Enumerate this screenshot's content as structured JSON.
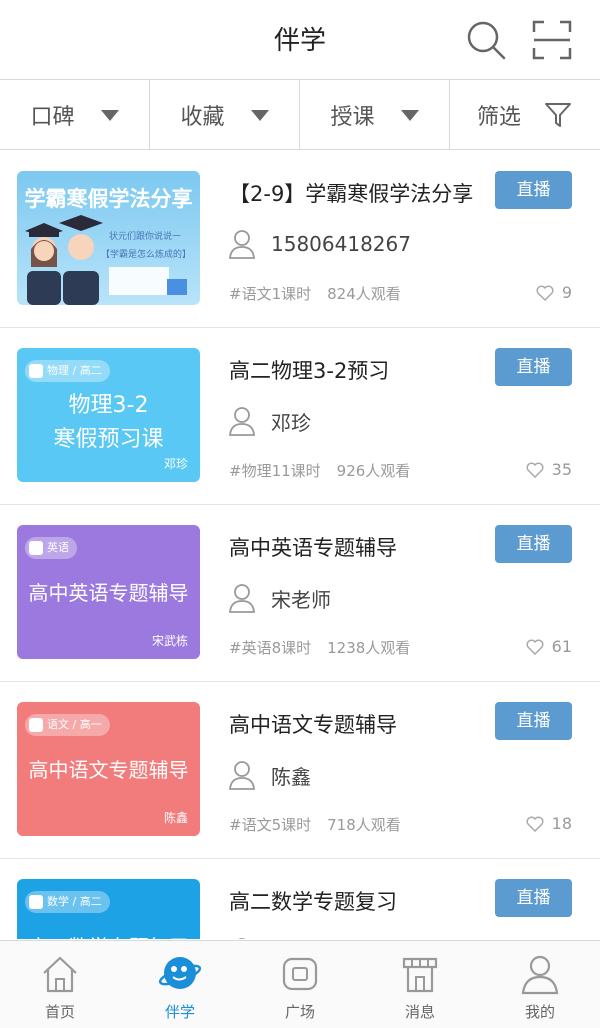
{
  "header": {
    "title": "伴学",
    "search_icon": "search-icon",
    "scan_icon": "scan-icon"
  },
  "filters": [
    {
      "label": "口碑",
      "icon": "dropdown-arrow-icon"
    },
    {
      "label": "收藏",
      "icon": "dropdown-arrow-icon"
    },
    {
      "label": "授课",
      "icon": "dropdown-arrow-icon"
    },
    {
      "label": "筛选",
      "icon": "filter-funnel-icon"
    }
  ],
  "courses": [
    {
      "title": "【2-9】学霸寒假学法分享",
      "teacher": "15806418267",
      "subject_hours": "#语文1课时",
      "viewers": "824人观看",
      "likes": "9",
      "button": "直播",
      "thumb": {
        "heading": "学霸寒假学法分享",
        "line1": "状元们跟你说说一",
        "line2": "【学霸是怎么炼成的】",
        "color": "#8fd0f2"
      }
    },
    {
      "title": "高二物理3-2预习",
      "teacher": "邓珍",
      "subject_hours": "#物理11课时",
      "viewers": "926人观看",
      "likes": "35",
      "button": "直播",
      "thumb": {
        "tag": "物理 / 高二",
        "line1": "物理3-2",
        "line2": "寒假预习课",
        "teacher": "邓珍",
        "color": "#5ac8f5"
      }
    },
    {
      "title": "高中英语专题辅导",
      "teacher": "宋老师",
      "subject_hours": "#英语8课时",
      "viewers": "1238人观看",
      "likes": "61",
      "button": "直播",
      "thumb": {
        "tag": "英语",
        "line1": "高中英语专题辅导",
        "teacher": "宋武栋",
        "color": "#9b79de"
      }
    },
    {
      "title": "高中语文专题辅导",
      "teacher": "陈鑫",
      "subject_hours": "#语文5课时",
      "viewers": "718人观看",
      "likes": "18",
      "button": "直播",
      "thumb": {
        "tag": "语文 / 高一",
        "line1": "高中语文专题辅导",
        "teacher": "陈鑫",
        "color": "#f27b7b"
      }
    },
    {
      "title": "高二数学专题复习",
      "teacher": "",
      "subject_hours": "",
      "viewers": "",
      "likes": "",
      "button": "直播",
      "thumb": {
        "tag": "数学 / 高二",
        "line1": "高二数学专题复习",
        "teacher": "",
        "color": "#1ea2e6"
      }
    }
  ],
  "tabs": [
    {
      "label": "首页",
      "icon": "home-icon",
      "active": false
    },
    {
      "label": "伴学",
      "icon": "planet-mascot-icon",
      "active": true
    },
    {
      "label": "广场",
      "icon": "square-icon",
      "active": false
    },
    {
      "label": "消息",
      "icon": "shop-icon",
      "active": false
    },
    {
      "label": "我的",
      "icon": "user-icon",
      "active": false
    }
  ],
  "colors": {
    "accent": "#5b9bcf",
    "tab_active": "#1a8ed8"
  }
}
